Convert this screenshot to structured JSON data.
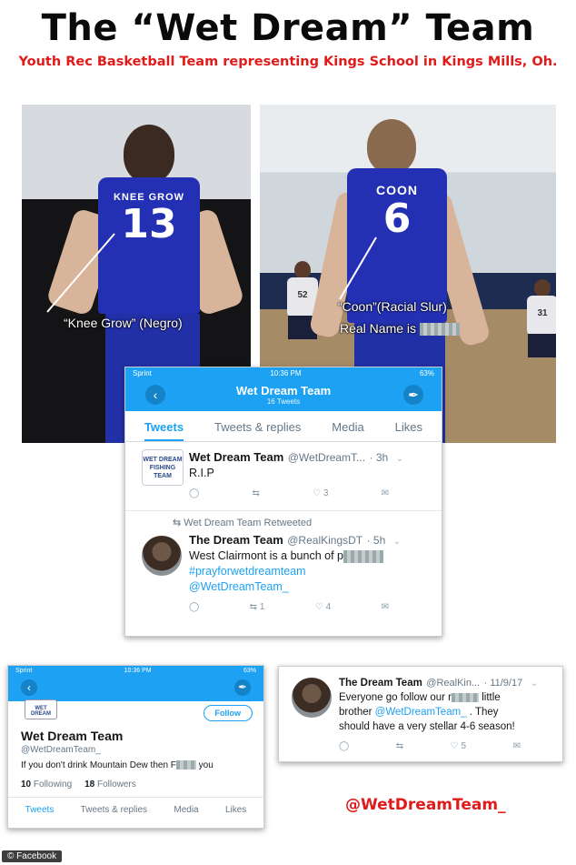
{
  "headline": {
    "title": "The “Wet Dream” Team",
    "subtitle": "Youth Rec Basketball Team representing Kings School in Kings Mills, Oh."
  },
  "photo_left": {
    "jersey_name": "KNEE GROW",
    "jersey_number": "13",
    "annotation": "“Knee Grow” (Negro)"
  },
  "photo_right": {
    "jersey_name": "COON",
    "jersey_number": "6",
    "annotation_line1": "“Coon”(Racial Slur)",
    "annotation_line2": "Real Name is",
    "bg_player1_number": "52",
    "bg_player2_number": "31"
  },
  "feed_panel": {
    "status": {
      "carrier": "Sprint",
      "time": "10:36 PM",
      "battery": "63%"
    },
    "nav": {
      "title": "Wet Dream Team",
      "count": "16 Tweets"
    },
    "tabs": [
      "Tweets",
      "Tweets & replies",
      "Media",
      "Likes"
    ],
    "tweet1": {
      "avatar_text": "WET DREAM FISHING TEAM",
      "name": "Wet Dream Team",
      "handle": "@WetDreamT...",
      "time": "· 3h",
      "text": "R.I.P",
      "likes": "3"
    },
    "retweet_label": "Wet Dream Team Retweeted",
    "tweet2": {
      "name": "The Dream Team",
      "handle": "@RealKingsDT",
      "time": "· 5h",
      "text": "West Clairmont is a bunch of p",
      "hashtag": "#prayforwetdreamteam",
      "mention": "@WetDreamTeam_",
      "retweets": "1",
      "likes": "4"
    }
  },
  "profile_panel": {
    "status": {
      "carrier": "Sprint",
      "time": "10:36 PM",
      "battery": "63%"
    },
    "follow_label": "Follow",
    "logo_text": "WET DREAM",
    "name": "Wet Dream Team",
    "handle": "@WetDreamTeam_",
    "bio_start": "If you don't drink Mountain Dew then F",
    "bio_end": "you",
    "following_count": "10",
    "following_label": "Following",
    "followers_count": "18",
    "followers_label": "Followers",
    "tabs": [
      "Tweets",
      "Tweets & replies",
      "Media",
      "Likes"
    ]
  },
  "single_tweet": {
    "name": "The Dream Team",
    "handle": "@RealKin...",
    "date": "· 11/9/17",
    "text_start": "Everyone go follow our r",
    "text_mid": "little",
    "text_line2": "brother",
    "mention": "@WetDreamTeam_",
    "text_line2_end": ". They",
    "text_line3": "should have a very stellar 4-6 season!",
    "likes": "5"
  },
  "handle_callout": "@WetDreamTeam_",
  "credit": "© Facebook",
  "colors": {
    "twitter_blue": "#1da1f2",
    "headline_red": "#e01b1b",
    "jersey_blue": "#2330b4"
  }
}
